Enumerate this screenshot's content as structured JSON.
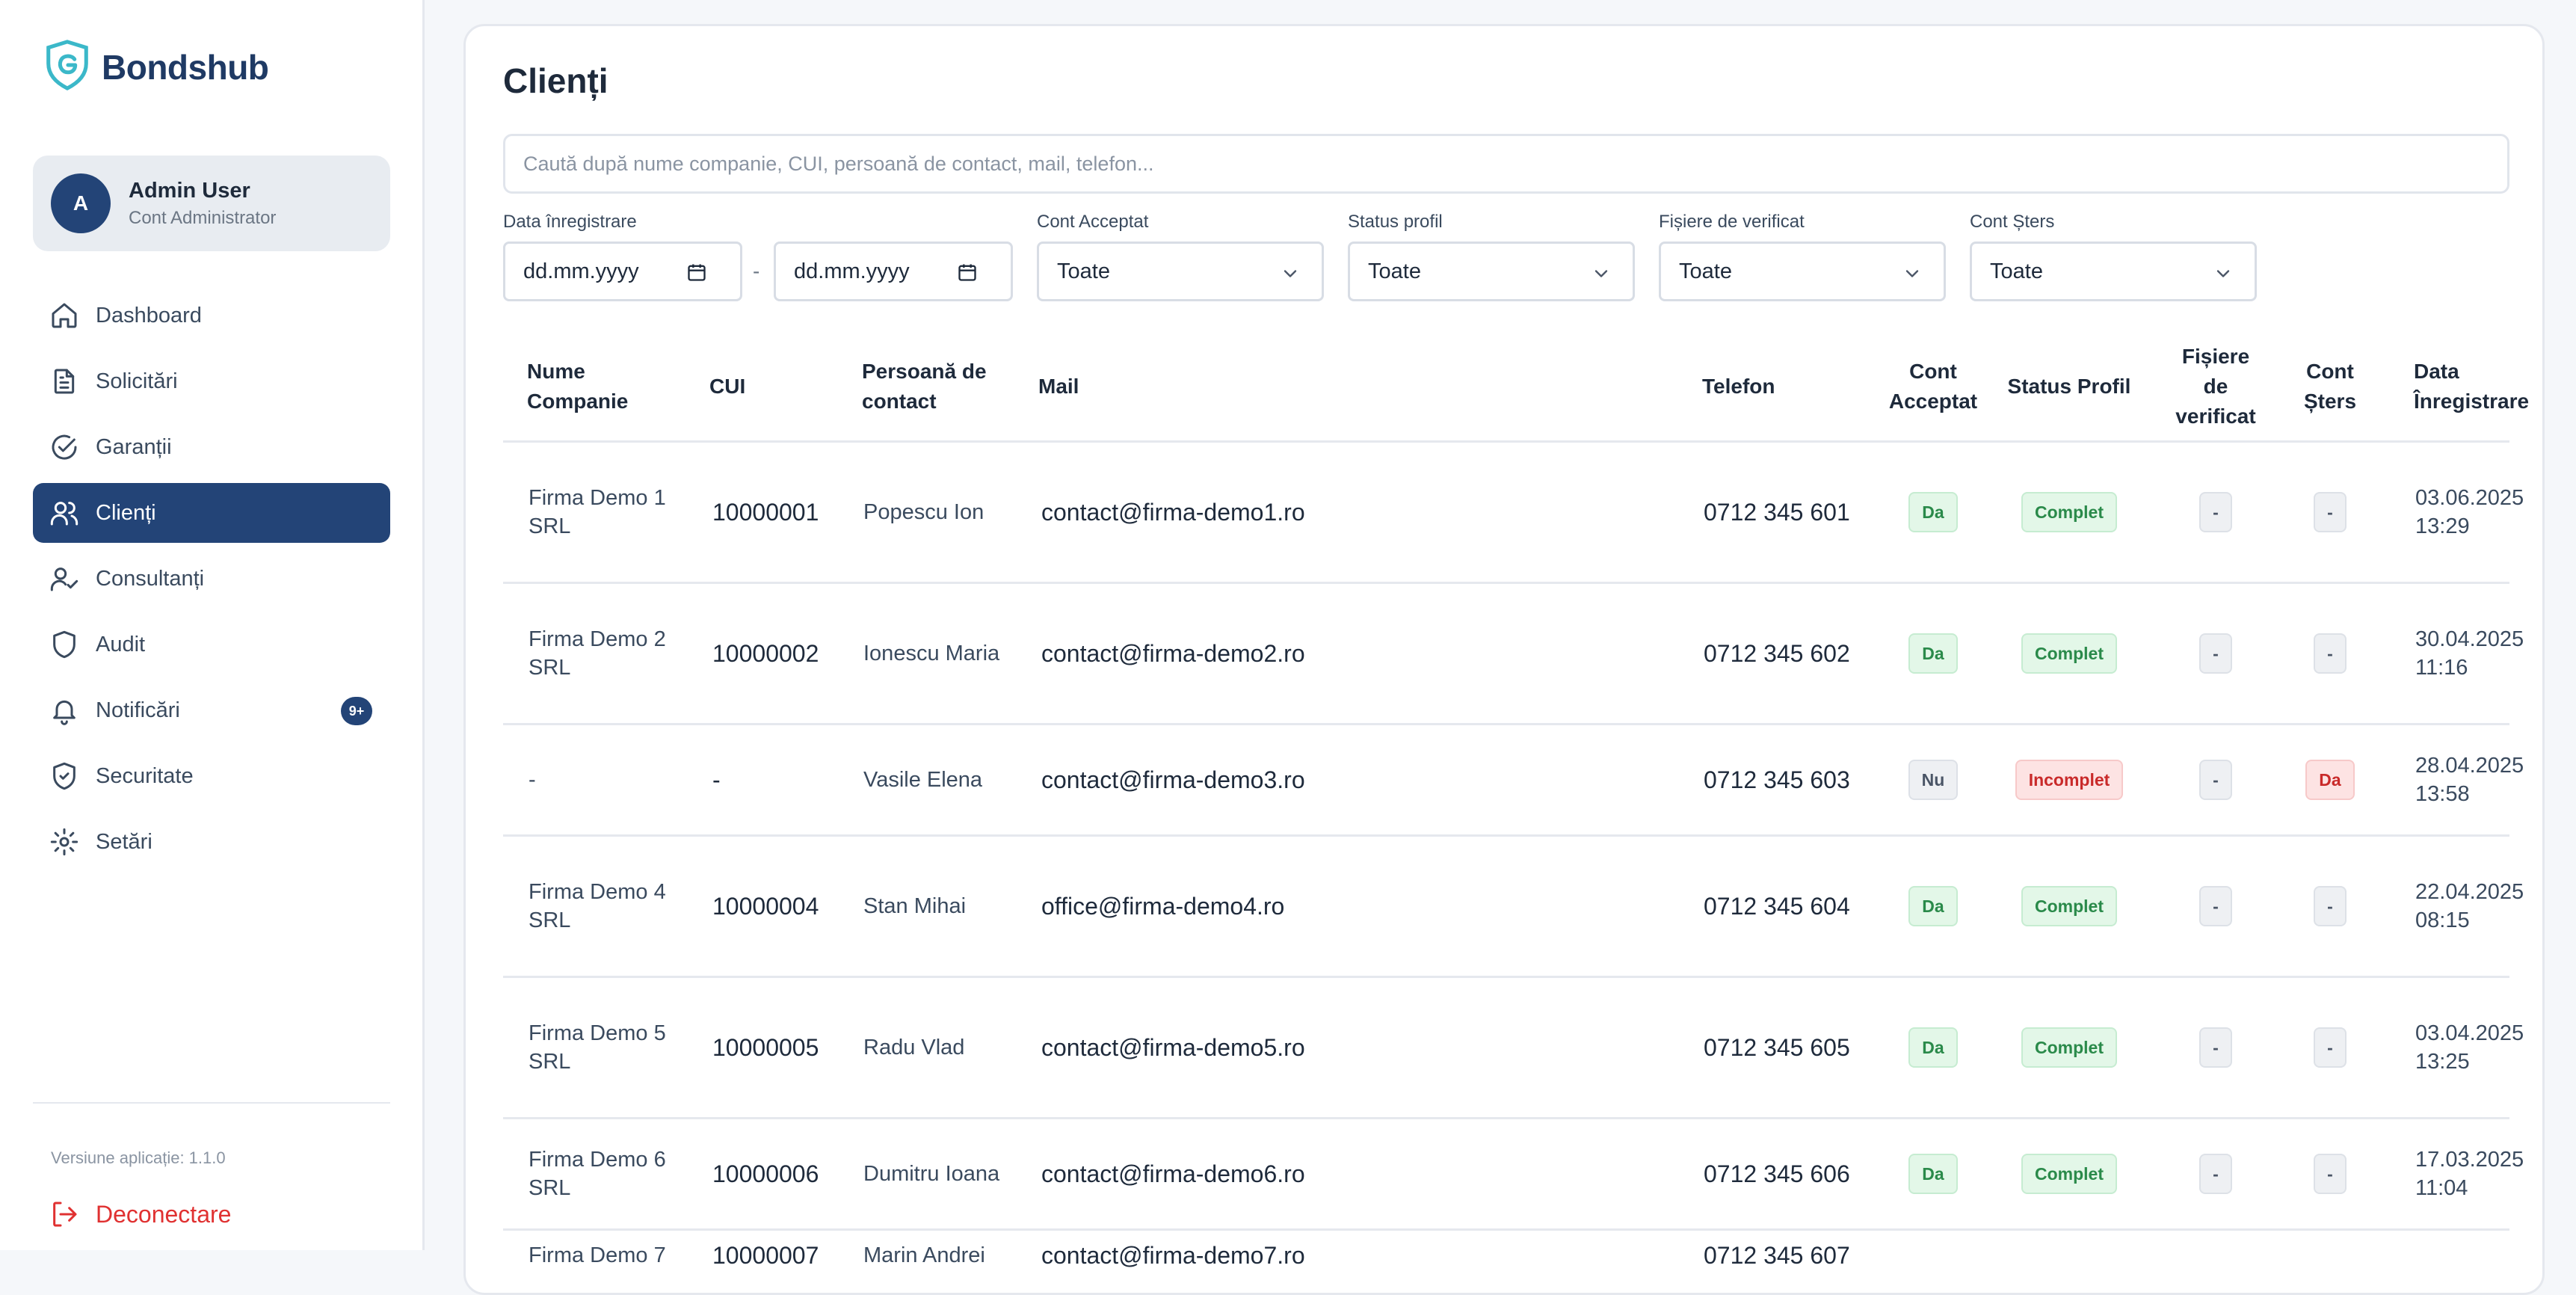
{
  "app": {
    "name": "Bondshub"
  },
  "user": {
    "initial": "A",
    "name": "Admin User",
    "role": "Cont Administrator"
  },
  "nav": {
    "items": [
      {
        "label": "Dashboard"
      },
      {
        "label": "Solicitări"
      },
      {
        "label": "Garanții"
      },
      {
        "label": "Clienți"
      },
      {
        "label": "Consultanți"
      },
      {
        "label": "Audit"
      },
      {
        "label": "Notificări",
        "badge": "9+"
      },
      {
        "label": "Securitate"
      },
      {
        "label": "Setări"
      }
    ],
    "active": "Clienți"
  },
  "footer": {
    "version": "Versiune aplicație: 1.1.0",
    "logout": "Deconectare"
  },
  "page": {
    "title": "Clienți",
    "search_placeholder": "Caută după nume companie, CUI, persoană de contact, mail, telefon..."
  },
  "filters": {
    "date_label": "Data înregistrare",
    "date_from": "dd.mm.yyyy",
    "date_separator": "-",
    "date_to": "dd.mm.yyyy",
    "cont_acceptat": {
      "label": "Cont Acceptat",
      "value": "Toate"
    },
    "status_profil": {
      "label": "Status profil",
      "value": "Toate"
    },
    "fisiere": {
      "label": "Fișiere de verificat",
      "value": "Toate"
    },
    "cont_sters": {
      "label": "Cont Șters",
      "value": "Toate"
    }
  },
  "table": {
    "headers": {
      "nume": "Nume Companie",
      "cui": "CUI",
      "persoana": "Persoană de contact",
      "mail": "Mail",
      "telefon": "Telefon",
      "acceptat": "Cont Acceptat",
      "status": "Status Profil",
      "fisiere": "Fișiere de verificat",
      "sters": "Cont Șters",
      "data": "Data Înregistrare"
    },
    "rows": [
      {
        "nume": "Firma Demo 1 SRL",
        "cui": "10000001",
        "persoana": "Popescu Ion",
        "mail": "contact@firma-demo1.ro",
        "telefon": "0712 345 601",
        "acceptat": "Da",
        "status": "Complet",
        "fisiere": "-",
        "sters": "-",
        "data": "03.06.2025 13:29"
      },
      {
        "nume": "Firma Demo 2 SRL",
        "cui": "10000002",
        "persoana": "Ionescu Maria",
        "mail": "contact@firma-demo2.ro",
        "telefon": "0712 345 602",
        "acceptat": "Da",
        "status": "Complet",
        "fisiere": "-",
        "sters": "-",
        "data": "30.04.2025 11:16"
      },
      {
        "nume": "-",
        "cui": "-",
        "persoana": "Vasile Elena",
        "mail": "contact@firma-demo3.ro",
        "telefon": "0712 345 603",
        "acceptat": "Nu",
        "status": "Incomplet",
        "fisiere": "-",
        "sters": "Da",
        "data": "28.04.2025 13:58"
      },
      {
        "nume": "Firma Demo 4 SRL",
        "cui": "10000004",
        "persoana": "Stan Mihai",
        "mail": "office@firma-demo4.ro",
        "telefon": "0712 345 604",
        "acceptat": "Da",
        "status": "Complet",
        "fisiere": "-",
        "sters": "-",
        "data": "22.04.2025 08:15"
      },
      {
        "nume": "Firma Demo 5 SRL",
        "cui": "10000005",
        "persoana": "Radu Vlad",
        "mail": "contact@firma-demo5.ro",
        "telefon": "0712 345 605",
        "acceptat": "Da",
        "status": "Complet",
        "fisiere": "-",
        "sters": "-",
        "data": "03.04.2025 13:25"
      },
      {
        "nume": "Firma Demo 6 SRL",
        "cui": "10000006",
        "persoana": "Dumitru Ioana",
        "mail": "contact@firma-demo6.ro",
        "telefon": "0712 345 606",
        "acceptat": "Da",
        "status": "Complet",
        "fisiere": "-",
        "sters": "-",
        "data": "17.03.2025 11:04"
      },
      {
        "nume": "Firma Demo 7",
        "cui": "10000007",
        "persoana": "Marin Andrei",
        "mail": "contact@firma-demo7.ro",
        "telefon": "0712 345 607",
        "acceptat": "",
        "status": "",
        "fisiere": "",
        "sters": "",
        "data": ""
      }
    ]
  },
  "colors": {
    "primary": "#234477",
    "danger": "#e03131",
    "success_bg": "#e3f7e8",
    "danger_bg": "#fde3e3"
  }
}
